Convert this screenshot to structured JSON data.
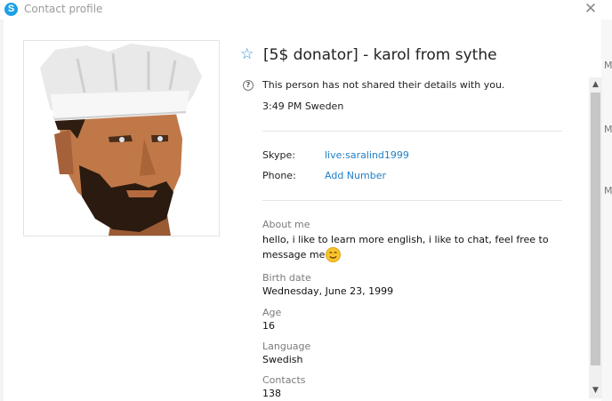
{
  "window": {
    "title": "Contact profile",
    "close_glyph": "✕"
  },
  "app_logo_letter": "S",
  "background_glyphs": [
    "M",
    "M",
    "M"
  ],
  "profile": {
    "display_name": "[5$ donator] - karol from sythe",
    "privacy_note": "This person has not shared their details with you.",
    "local_time": "3:49 PM Sweden",
    "star_glyph": "☆",
    "info_glyph": "?"
  },
  "contact": {
    "skype_label": "Skype:",
    "skype_value": "live:saralind1999",
    "phone_label": "Phone:",
    "phone_action": "Add Number"
  },
  "details": {
    "about_label": "About me",
    "about_text": "hello, i like to learn more english, i like to chat, feel free to message me",
    "birth_label": "Birth date",
    "birth_value": "Wednesday, June 23, 1999",
    "age_label": "Age",
    "age_value": "16",
    "language_label": "Language",
    "language_value": "Swedish",
    "contacts_label": "Contacts",
    "contacts_value": "138"
  },
  "scrollbar": {
    "up_glyph": "▲",
    "down_glyph": "▼"
  },
  "colors": {
    "link": "#1e7fc8",
    "accent": "#2b90d9",
    "skype_blue": "#1ea0e6"
  }
}
